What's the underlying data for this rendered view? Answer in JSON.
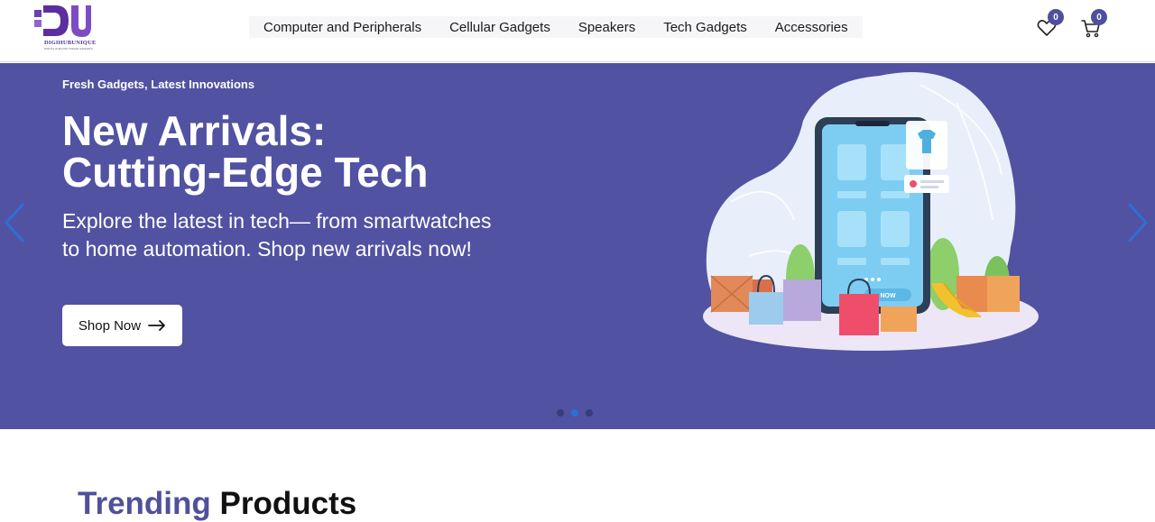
{
  "brand": {
    "name": "DIGIHUBUNIQUE",
    "tagline": "DIGITAL HUB FOR UNIQUE GADGETS"
  },
  "nav": {
    "items": [
      {
        "label": "Computer and Peripherals"
      },
      {
        "label": "Cellular Gadgets"
      },
      {
        "label": "Speakers"
      },
      {
        "label": "Tech Gadgets"
      },
      {
        "label": "Accessories"
      }
    ]
  },
  "header": {
    "wishlist_count": "0",
    "cart_count": "0",
    "wishlist_icon": "heart-icon",
    "cart_icon": "cart-icon"
  },
  "hero": {
    "eyebrow": "Fresh Gadgets, Latest Innovations",
    "title_line1": "New Arrivals:",
    "title_line2": "Cutting-Edge Tech",
    "subtitle": "Explore the latest in tech— from smartwatches to home automation. Shop new arrivals now!",
    "cta_label": "Shop Now",
    "illustration_button": "NOW",
    "slide_count": 3,
    "active_slide": 2
  },
  "trending": {
    "accent_word": "Trending",
    "rest_word": "Products"
  },
  "colors": {
    "hero_bg": "#5152a2",
    "accent": "#50509c",
    "arrow": "#2d6fd6"
  }
}
